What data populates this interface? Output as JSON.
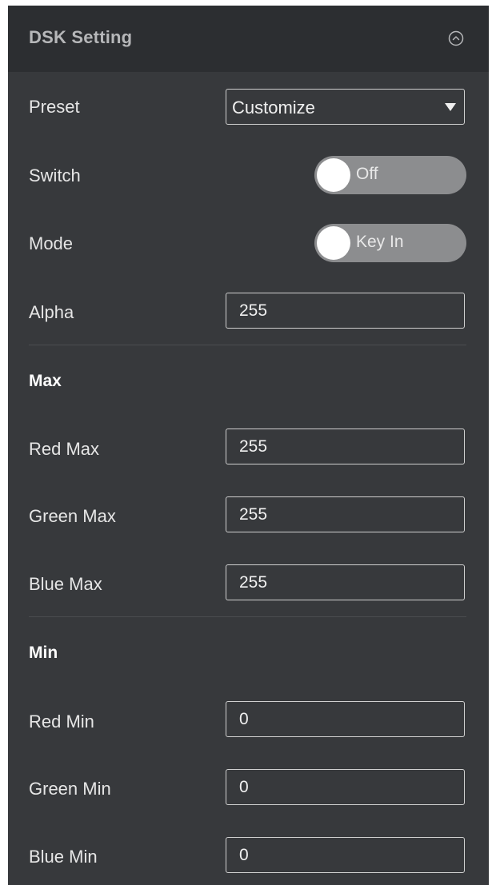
{
  "header": {
    "title": "DSK Setting",
    "collapse_icon": "chevron-up-circle-icon"
  },
  "preset": {
    "label": "Preset",
    "value": "Customize"
  },
  "switch": {
    "label": "Switch",
    "state": "Off"
  },
  "mode": {
    "label": "Mode",
    "state": "Key In"
  },
  "alpha": {
    "label": "Alpha",
    "value": "255"
  },
  "max_section": {
    "title": "Max",
    "red": {
      "label": "Red Max",
      "value": "255"
    },
    "green": {
      "label": "Green Max",
      "value": "255"
    },
    "blue": {
      "label": "Blue Max",
      "value": "255"
    }
  },
  "min_section": {
    "title": "Min",
    "red": {
      "label": "Red Min",
      "value": "0"
    },
    "green": {
      "label": "Green Min",
      "value": "0"
    },
    "blue": {
      "label": "Blue Min",
      "value": "0"
    }
  },
  "colors": {
    "panel_bg": "#37393c",
    "header_bg": "#2c2e31",
    "toggle_track": "#8c8d8f"
  }
}
